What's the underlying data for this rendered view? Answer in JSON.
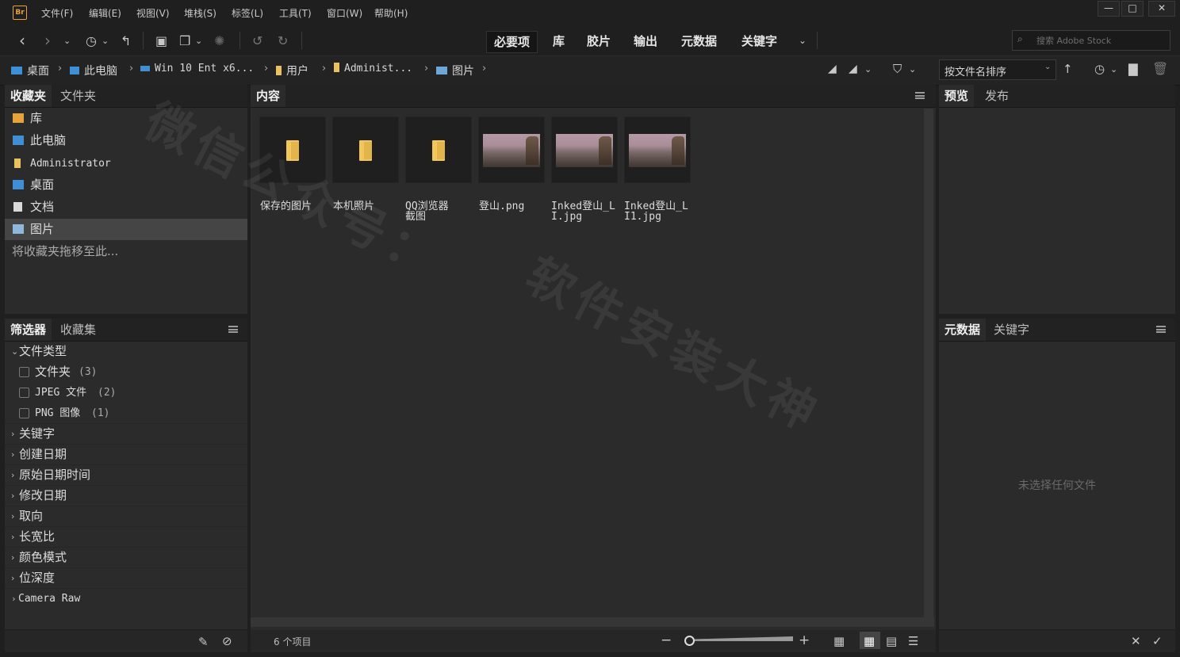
{
  "app": {
    "logo": "Br"
  },
  "menu": [
    "文件(F)",
    "编辑(E)",
    "视图(V)",
    "堆栈(S)",
    "标签(L)",
    "工具(T)",
    "窗口(W)",
    "帮助(H)"
  ],
  "window_controls": {
    "minimize": "minimize-icon",
    "maximize": "maximize-icon",
    "close": "close-icon"
  },
  "workspaces": [
    "必要项",
    "库",
    "胶片",
    "输出",
    "元数据",
    "关键字"
  ],
  "search": {
    "placeholder": "搜索 Adobe Stock"
  },
  "breadcrumb": [
    "桌面",
    "此电脑",
    "Win 10 Ent x6...",
    "用户",
    "Administ...",
    "图片"
  ],
  "sort": {
    "label": "按文件名排序"
  },
  "favorites_panel": {
    "tabs": [
      "收藏夹",
      "文件夹"
    ],
    "items": [
      "库",
      "此电脑",
      "Administrator",
      "桌面",
      "文档",
      "图片"
    ],
    "drop_hint": "将收藏夹拖移至此..."
  },
  "filter_panel": {
    "tabs": [
      "筛选器",
      "收藏集"
    ],
    "file_type_header": "文件类型",
    "file_types": [
      {
        "label": "文件夹",
        "count": "(3)"
      },
      {
        "label": "JPEG 文件",
        "count": "(2)"
      },
      {
        "label": "PNG 图像",
        "count": "(1)"
      }
    ],
    "categories": [
      "关键字",
      "创建日期",
      "原始日期时间",
      "修改日期",
      "取向",
      "长宽比",
      "颜色模式",
      "位深度",
      "Camera Raw"
    ]
  },
  "content_panel": {
    "tab": "内容",
    "items": [
      {
        "label": "保存的图片",
        "kind": "folder"
      },
      {
        "label": "本机照片",
        "kind": "folder"
      },
      {
        "label": "QQ浏览器截图",
        "kind": "folder"
      },
      {
        "label": "登山.png",
        "kind": "image"
      },
      {
        "label": "Inked登山_LI.jpg",
        "kind": "image"
      },
      {
        "label": "Inked登山_LI1.jpg",
        "kind": "image"
      }
    ],
    "item_count": "6 个项目"
  },
  "preview_panel": {
    "tabs": [
      "预览",
      "发布"
    ]
  },
  "metadata_panel": {
    "tabs": [
      "元数据",
      "关键字"
    ],
    "empty_text": "未选择任何文件"
  },
  "watermark": [
    "微信公众号：",
    "软件安装大神"
  ],
  "colors": {
    "accent_folder": "#e8c25f",
    "pc_blue": "#3f8fd6",
    "logo_orange": "#e8a23a"
  }
}
